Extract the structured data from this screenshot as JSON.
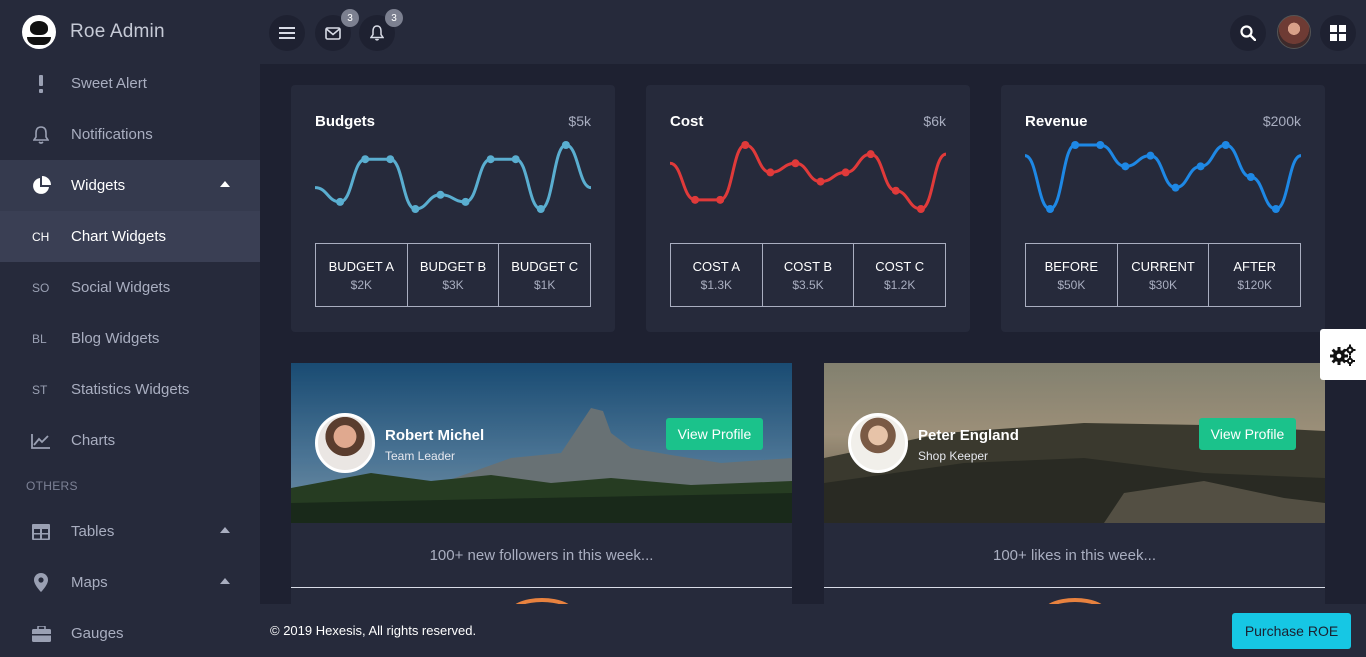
{
  "brand": {
    "name": "Roe Admin"
  },
  "sidebar": {
    "items": [
      {
        "label": "Sweet Alert",
        "icon": "exclamation-icon"
      },
      {
        "label": "Notifications",
        "icon": "bell-icon"
      },
      {
        "label": "Widgets",
        "icon": "pie-chart-icon"
      }
    ],
    "sub_items": [
      {
        "abbr": "CH",
        "label": "Chart Widgets"
      },
      {
        "abbr": "SO",
        "label": "Social Widgets"
      },
      {
        "abbr": "BL",
        "label": "Blog Widgets"
      },
      {
        "abbr": "ST",
        "label": "Statistics Widgets"
      }
    ],
    "charts_label": "Charts",
    "section_label": "OTHERS",
    "others": [
      {
        "label": "Tables",
        "icon": "table-icon"
      },
      {
        "label": "Maps",
        "icon": "map-pin-icon"
      },
      {
        "label": "Gauges",
        "icon": "briefcase-icon"
      }
    ]
  },
  "topbar": {
    "mail_badge": "3",
    "bell_badge": "3"
  },
  "cards": [
    {
      "title": "Budgets",
      "amount": "$5k",
      "color": "#5aaed0",
      "stats": [
        {
          "label": "BUDGET A",
          "value": "$2K"
        },
        {
          "label": "BUDGET B",
          "value": "$3K"
        },
        {
          "label": "BUDGET C",
          "value": "$1K"
        }
      ]
    },
    {
      "title": "Cost",
      "amount": "$6k",
      "color": "#e03a3a",
      "stats": [
        {
          "label": "COST A",
          "value": "$1.3K"
        },
        {
          "label": "COST B",
          "value": "$3.5K"
        },
        {
          "label": "COST C",
          "value": "$1.2K"
        }
      ]
    },
    {
      "title": "Revenue",
      "amount": "$200k",
      "color": "#1e88e5",
      "stats": [
        {
          "label": "BEFORE",
          "value": "$50K"
        },
        {
          "label": "CURRENT",
          "value": "$30K"
        },
        {
          "label": "AFTER",
          "value": "$120K"
        }
      ]
    }
  ],
  "chart_data": [
    {
      "type": "line",
      "values": [
        3,
        1,
        7,
        7,
        0,
        2,
        1,
        7,
        7,
        0,
        9,
        3
      ]
    },
    {
      "type": "line",
      "values": [
        5,
        1,
        1,
        7,
        4,
        5,
        3,
        4,
        6,
        2,
        0,
        6
      ]
    },
    {
      "type": "line",
      "values": [
        5,
        0,
        6,
        6,
        4,
        5,
        2,
        4,
        6,
        3,
        0,
        5
      ]
    }
  ],
  "profiles": [
    {
      "name": "Robert Michel",
      "role": "Team Leader",
      "button": "View Profile",
      "note": "100+ new followers in this week..."
    },
    {
      "name": "Peter England",
      "role": "Shop Keeper",
      "button": "View Profile",
      "note": "100+ likes in this week..."
    }
  ],
  "footer": {
    "copyright": "© 2019 Hexesis, All rights reserved.",
    "purchase": "Purchase ROE"
  }
}
